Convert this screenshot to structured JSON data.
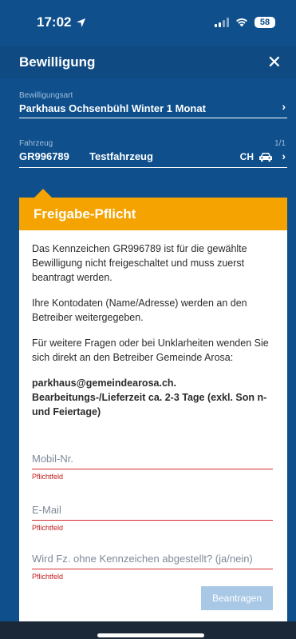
{
  "status": {
    "time": "17:02",
    "battery": "58"
  },
  "nav": {
    "title": "Bewilligung",
    "close": "✕"
  },
  "permit_type": {
    "label": "Bewilligungsart",
    "value": "Parkhaus Ochsenbühl Winter 1 Monat"
  },
  "vehicle": {
    "label": "Fahrzeug",
    "counter": "1/1",
    "plate": "GR996789",
    "name": "Testfahrzeug",
    "country": "CH"
  },
  "card": {
    "title": "Freigabe-Pflicht",
    "paragraphs": [
      "Das Kennzeichen GR996789 ist für die gewählte Bewilligung nicht freigeschaltet und muss zuerst beantragt werden.",
      "Ihre Kontodaten (Name/Adresse) werden an den Betreiber weitergegeben.",
      "Für weitere Fragen oder bei Unklarheiten wenden Sie sich direkt an den Betreiber Gemeinde Arosa:"
    ],
    "contact": "parkhaus@gemeindearosa.ch.",
    "delivery": "Bearbeitungs-/Lieferzeit ca. 2-3 Tage (exkl. Son n-und Feiertage)"
  },
  "form": {
    "mobile_placeholder": "Mobil-Nr.",
    "email_placeholder": "E-Mail",
    "plate_question_placeholder": "Wird Fz. ohne Kennzeichen abgestellt? (ja/nein)",
    "required": "Pflichtfeld",
    "submit": "Beantragen"
  },
  "colors": {
    "background": "#0e4f8c",
    "accent": "#f5a300",
    "error": "#c11d1d"
  },
  "icons": [
    "location-arrow-icon",
    "signal-icon",
    "wifi-icon",
    "battery-icon",
    "close-icon",
    "chevron-right-icon",
    "car-icon"
  ]
}
